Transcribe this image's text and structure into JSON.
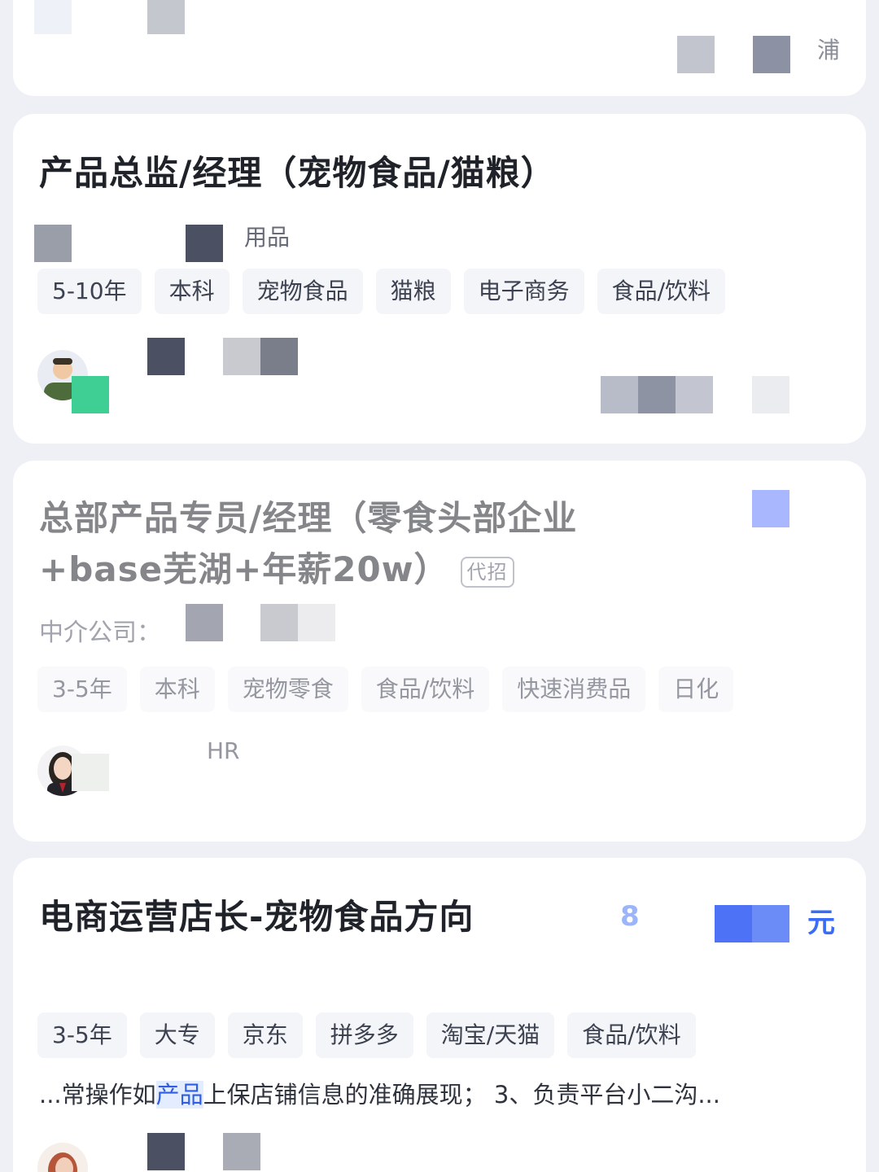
{
  "card0": {
    "location_tail": "浦"
  },
  "card1": {
    "title": "产品总监/经理（宠物食品/猫粮）",
    "company_tail": "用品",
    "tags": [
      "5-10年",
      "本科",
      "宠物食品",
      "猫粮",
      "电子商务",
      "食品/饮料"
    ]
  },
  "card2": {
    "title_line1": "总部产品专员/经理（零食头部企业",
    "title_line2": "+base芜湖+年薪20w）",
    "badge": "代招",
    "agency_label": "中介公司：",
    "tags": [
      "3-5年",
      "本科",
      "宠物零食",
      "食品/饮料",
      "快速消费品",
      "日化"
    ],
    "recruiter_role": "HR"
  },
  "card3": {
    "title": "电商运营店长-宠物食品方向",
    "salary_head": "8",
    "salary_unit": "元",
    "tags": [
      "3-5年",
      "大专",
      "京东",
      "拼多多",
      "淘宝/天猫",
      "食品/饮料"
    ],
    "desc_pre": "...常操作如",
    "desc_hl": "产品",
    "desc_post": "上保店铺信息的准确展现； 3、负责平台小二沟..."
  },
  "colors": {
    "background": "#eef0f5",
    "card": "#ffffff",
    "accent": "#3a6cf6",
    "tag_bg": "#f4f5f9"
  }
}
